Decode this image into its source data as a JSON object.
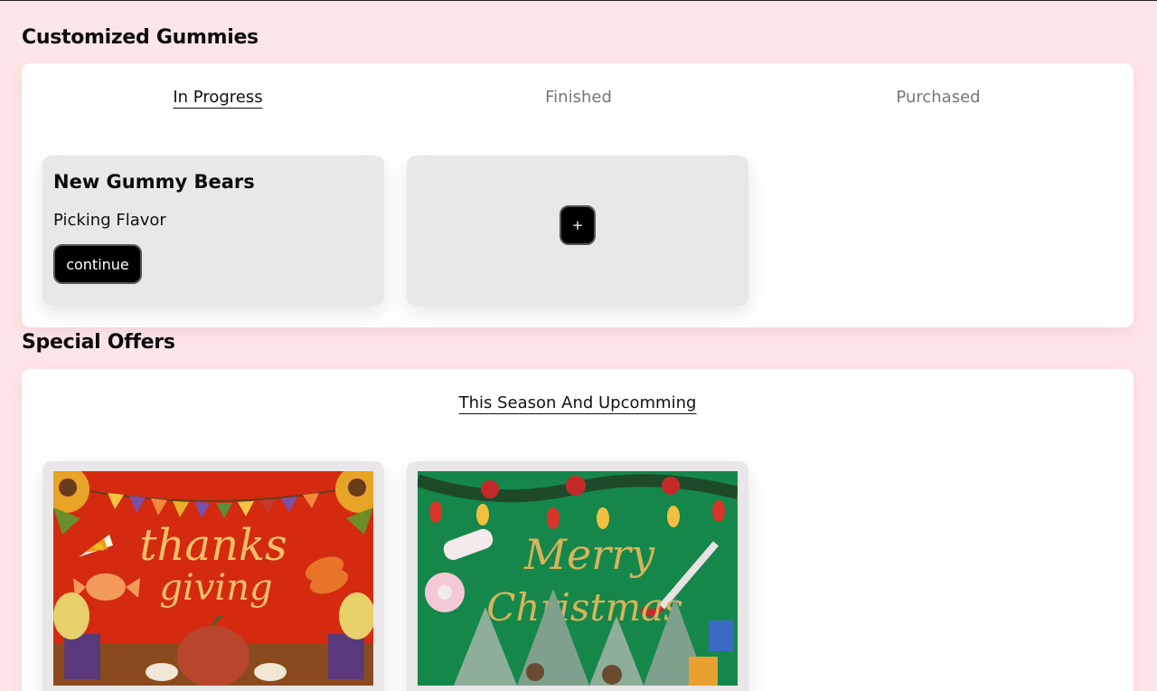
{
  "customized": {
    "title": "Customized Gummies",
    "tabs": [
      {
        "label": "In Progress",
        "active": true
      },
      {
        "label": "Finished",
        "active": false
      },
      {
        "label": "Purchased",
        "active": false
      }
    ],
    "card": {
      "title": "New Gummy Bears",
      "status": "Picking Flavor",
      "button_label": "continue"
    },
    "add_label": "+"
  },
  "offers": {
    "title": "Special Offers",
    "tab": "This Season And Upcomming",
    "items": [
      {
        "image": "thanksgiving-card-image",
        "text": "thanks giving",
        "accent": "#d42a10"
      },
      {
        "image": "christmas-card-image",
        "text": "Merry Christmas",
        "accent": "#15874a"
      }
    ]
  },
  "colors": {
    "page_bg": "#fde6e8",
    "panel_bg": "#ffffff",
    "card_bg": "#eae7e8",
    "button_bg": "#000000"
  }
}
